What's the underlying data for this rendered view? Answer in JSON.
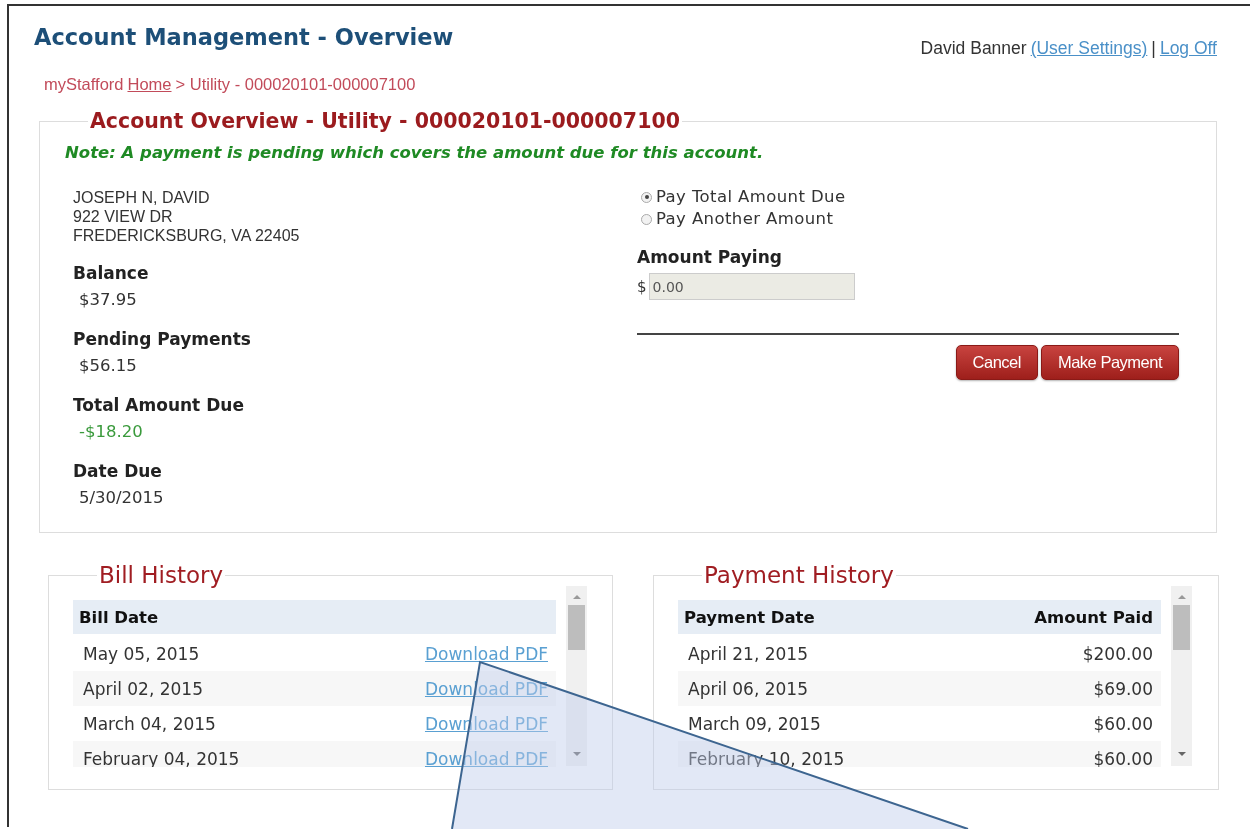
{
  "header": {
    "title": "Account Management - Overview",
    "user_name": "David Banner",
    "settings_link": "(User Settings)",
    "separator": "|",
    "logoff_link": "Log Off"
  },
  "breadcrumb": {
    "site": "myStafford",
    "home_link": "Home",
    "trail": "> Utility - 000020101-000007100"
  },
  "account": {
    "title": "Account Overview - Utility - 000020101-000007100",
    "note": "Note: A payment is pending which covers the amount due for this account.",
    "address": [
      "JOSEPH N, DAVID",
      "922 VIEW DR",
      "FREDERICKSBURG, VA 22405"
    ],
    "fields": [
      {
        "label": "Balance",
        "value": "$37.95",
        "kind": "plain"
      },
      {
        "label": "Pending Payments",
        "value": "$56.15",
        "kind": "plain"
      },
      {
        "label": "Total Amount Due",
        "value": "-$18.20",
        "kind": "credit"
      },
      {
        "label": "Date Due",
        "value": "5/30/2015",
        "kind": "plain"
      }
    ]
  },
  "payment": {
    "options": [
      {
        "label": "Pay Total Amount Due",
        "selected": true
      },
      {
        "label": "Pay Another Amount",
        "selected": false
      }
    ],
    "amount_label": "Amount Paying",
    "currency": "$",
    "amount_value": "0.00",
    "amount_disabled": true,
    "buttons": [
      "Cancel",
      "Make Payment"
    ]
  },
  "bill_history": {
    "title": "Bill History",
    "columns": [
      "Bill Date"
    ],
    "rows": [
      {
        "date": "May 05, 2015",
        "link": "Download PDF"
      },
      {
        "date": "April 02, 2015",
        "link": "Download PDF"
      },
      {
        "date": "March 04, 2015",
        "link": "Download PDF"
      },
      {
        "date": "February 04, 2015",
        "link": "Download PDF"
      }
    ]
  },
  "payment_history": {
    "title": "Payment History",
    "columns": [
      "Payment Date",
      "Amount Paid"
    ],
    "rows": [
      {
        "date": "April 21, 2015",
        "amount": "$200.00"
      },
      {
        "date": "April 06, 2015",
        "amount": "$69.00"
      },
      {
        "date": "March 09, 2015",
        "amount": "$60.00"
      },
      {
        "date": "February 10, 2015",
        "amount": "$60.00"
      }
    ]
  }
}
